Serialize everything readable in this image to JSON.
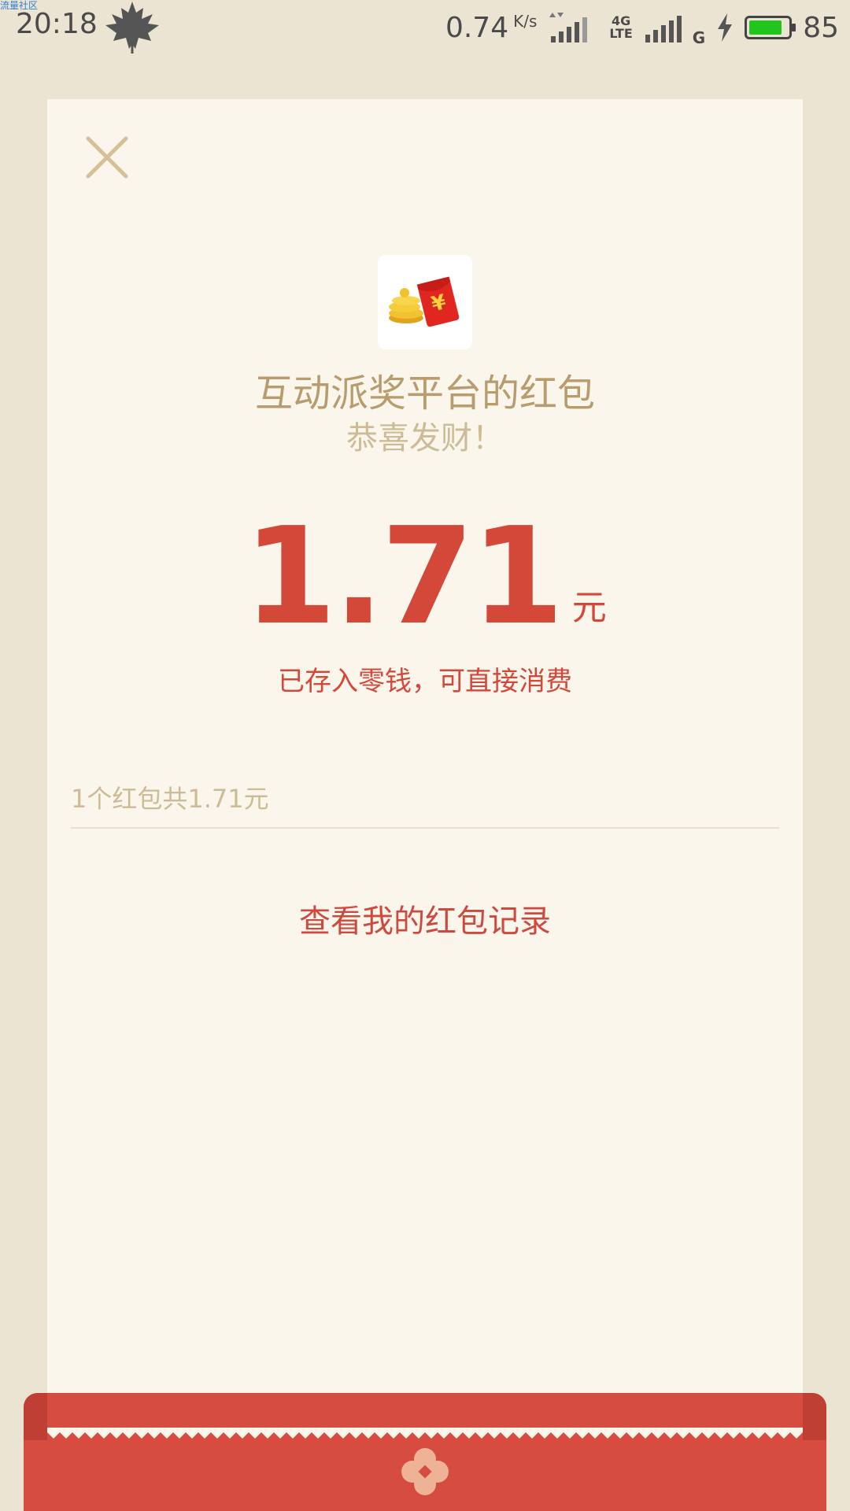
{
  "status_bar": {
    "watermark": "流量社区",
    "time": "20:18",
    "net_speed": "0.74",
    "net_speed_unit": "K/s",
    "network_4g": "4G",
    "network_lte": "LTE",
    "network_g": "G",
    "battery_percent": "85",
    "battery_level": 0.85,
    "battery_color": "#22c41e"
  },
  "card": {
    "title": "互动派奖平台的红包",
    "subtitle": "恭喜发财！",
    "amount": "1.71",
    "amount_unit": "元",
    "stored_text": "已存入零钱，可直接消费",
    "summary": "1个红包共1.71元",
    "records_link": "查看我的红包记录"
  },
  "colors": {
    "accent_red": "#d4483a",
    "gold_text": "#b89c6d",
    "background": "#ece4d3",
    "card": "#faf6ec"
  },
  "icons": {
    "close": "close-icon",
    "app": "red-envelope-coins-icon",
    "leaf": "maple-leaf-icon",
    "flower": "flower-icon"
  }
}
